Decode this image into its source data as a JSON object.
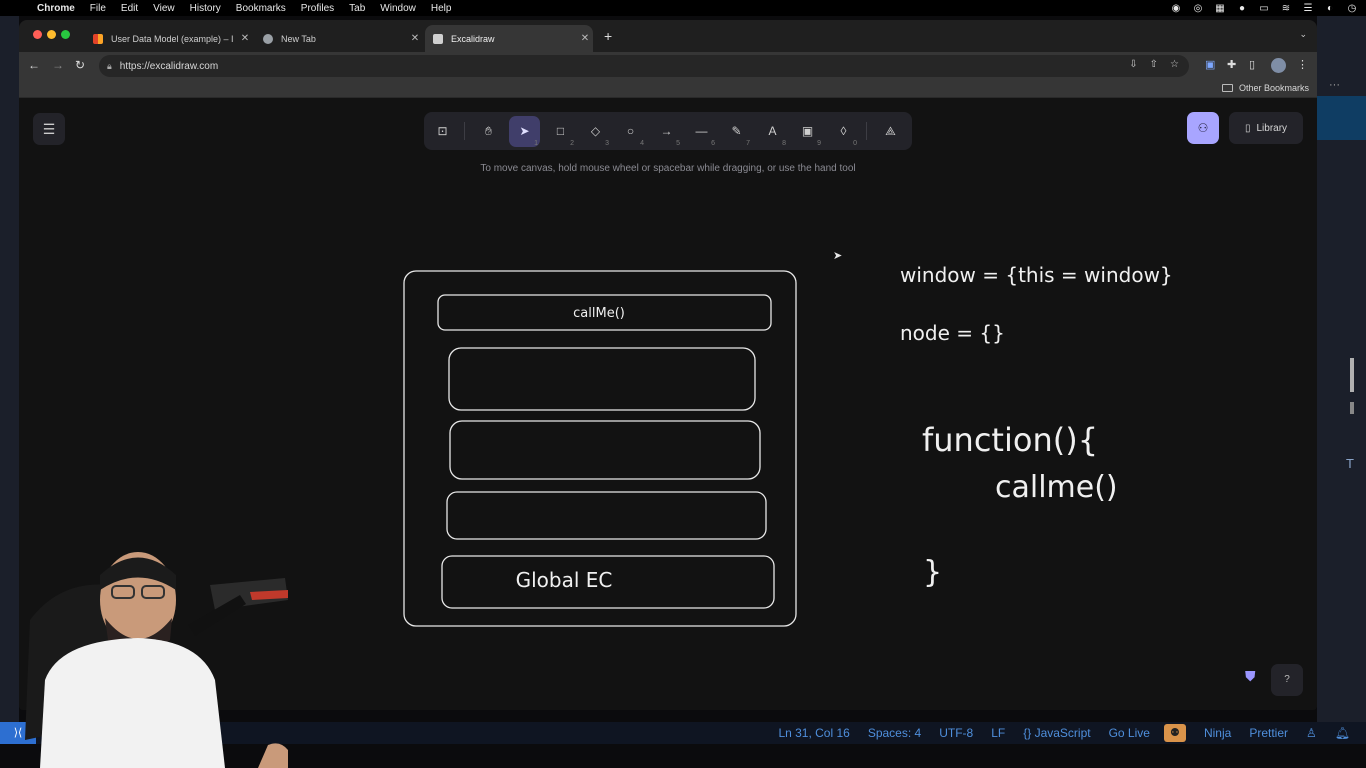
{
  "menubar": {
    "app": "Chrome",
    "items": [
      "File",
      "Edit",
      "View",
      "History",
      "Bookmarks",
      "Profiles",
      "Tab",
      "Window",
      "Help"
    ]
  },
  "tabs": [
    {
      "title": "User Data Model (example) – I",
      "icon": "gitlab-like-icon"
    },
    {
      "title": "New Tab",
      "icon": "chrome-icon"
    },
    {
      "title": "Excalidraw",
      "icon": "excalidraw-icon",
      "active": true
    }
  ],
  "address": {
    "url": "https://excalidraw.com"
  },
  "bookmarks": {
    "other": "Other Bookmarks"
  },
  "excalidraw": {
    "hint": "To move canvas, hold mouse wheel or spacebar while dragging, or use the hand tool",
    "library_label": "Library",
    "tools": [
      {
        "name": "lock-tool",
        "icon": "lock-icon",
        "key": ""
      },
      {
        "name": "hand-tool",
        "icon": "hand-icon",
        "key": ""
      },
      {
        "name": "selection-tool",
        "icon": "pointer-icon",
        "key": "1"
      },
      {
        "name": "rectangle-tool",
        "icon": "rectangle-icon",
        "key": "2"
      },
      {
        "name": "diamond-tool",
        "icon": "diamond-icon",
        "key": "3"
      },
      {
        "name": "ellipse-tool",
        "icon": "ellipse-icon",
        "key": "4"
      },
      {
        "name": "arrow-tool",
        "icon": "arrow-icon",
        "key": "5"
      },
      {
        "name": "line-tool",
        "icon": "line-icon",
        "key": "6"
      },
      {
        "name": "draw-tool",
        "icon": "pencil-icon",
        "key": "7"
      },
      {
        "name": "text-tool",
        "icon": "text-icon",
        "key": "8"
      },
      {
        "name": "image-tool",
        "icon": "image-icon",
        "key": "9"
      },
      {
        "name": "eraser-tool",
        "icon": "eraser-icon",
        "key": "0"
      },
      {
        "name": "more-tools",
        "icon": "shapes-icon",
        "key": ""
      }
    ]
  },
  "drawing": {
    "stack_top_label": "callMe()",
    "stack_bottom_label": "Global EC",
    "code_line1": "window = {this = window}",
    "code_line2": "node = {}",
    "fn_open": "function(){",
    "fn_call": "callme()",
    "fn_close": "}"
  },
  "statusbar": {
    "position": "Ln 31, Col 16",
    "spaces": "Spaces: 4",
    "encoding": "UTF-8",
    "eol": "LF",
    "language": "{} JavaScript",
    "golive": "Go Live",
    "ninja": "Ninja",
    "prettier": "Prettier"
  },
  "colors": {
    "accent": "#a8a5ff",
    "selected_tool": "#403e6a",
    "statusbar_text": "#4f8fdc"
  }
}
